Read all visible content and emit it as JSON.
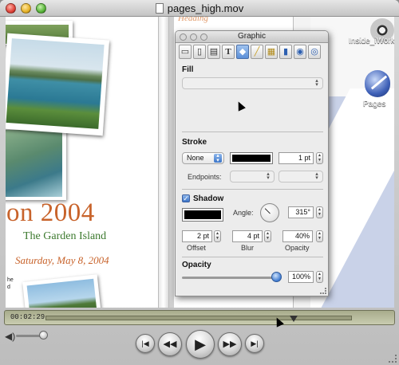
{
  "window": {
    "title": "pages_high.mov"
  },
  "document": {
    "faint_title": "Heading",
    "headline": "on 2004",
    "subhead": "The Garden Island",
    "dateline": "Saturday, May 8, 2004",
    "tiny_text": "he\nd"
  },
  "desktop": {
    "icons": [
      {
        "name": "dvd-icon",
        "label": "Inside_iWork"
      },
      {
        "name": "pages-app-icon",
        "label": "Pages"
      }
    ]
  },
  "inspector": {
    "title": "Graphic",
    "tabs": [
      "document-tab-icon",
      "layout-tab-icon",
      "wrap-tab-icon",
      "text-tab-icon",
      "graphic-tab-icon",
      "metrics-tab-icon",
      "table-tab-icon",
      "chart-tab-icon",
      "link-tab-icon",
      "quicktime-tab-icon"
    ],
    "text_tab_glyph": "T",
    "fill": {
      "label": "Fill"
    },
    "stroke": {
      "label": "Stroke",
      "style_value": "None",
      "width_value": "1 pt",
      "endpoints_label": "Endpoints:"
    },
    "shadow": {
      "label": "Shadow",
      "checked": true,
      "angle_label": "Angle:",
      "angle_value": "315°",
      "offset_value": "2 pt",
      "offset_label": "Offset",
      "blur_value": "4 pt",
      "blur_label": "Blur",
      "opacity_value": "40%",
      "opacity_label": "Opacity"
    },
    "opacity": {
      "label": "Opacity",
      "value": "100%",
      "level": 1.0
    }
  },
  "controller": {
    "time": "00:02:29",
    "position": 0.8
  },
  "colors": {
    "headline": "#c8632b",
    "subhead": "#3d7a2f",
    "inspector_bg": "#ececec",
    "timebar": "#b5b89a"
  }
}
